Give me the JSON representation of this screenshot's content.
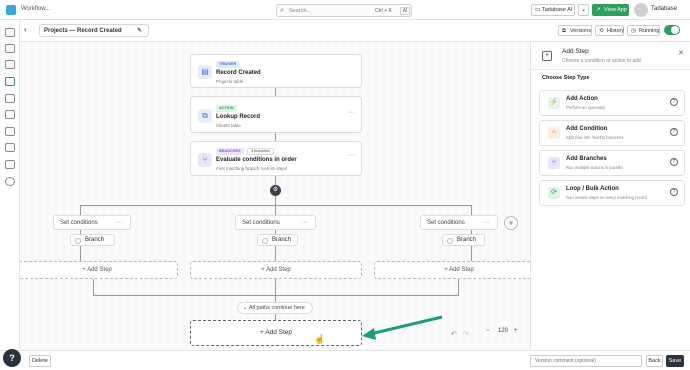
{
  "topbar": {
    "breadcrumb": "Workflow...",
    "search_placeholder": "Search...",
    "search_shortcut": "Ctrl + K",
    "search_ai": "AI",
    "tadabase_ai_label": "Tadabase AI",
    "view_app_label": "View App",
    "user_name": "Tadabase"
  },
  "toolbar": {
    "back_icon": "chevron-left-icon",
    "title": "Projects — Record Created",
    "versions_label": "Versions",
    "history_label": "History",
    "running_label": "Running",
    "running_on": true
  },
  "flow": {
    "trigger": {
      "tag": "Trigger",
      "title": "Record Created",
      "subtitle": "Projects table"
    },
    "action": {
      "tag": "Action",
      "title": "Lookup Record",
      "subtitle": "Clients table"
    },
    "branches": {
      "tag": "Branches",
      "count": "3 branches",
      "title": "Evaluate conditions in order",
      "subtitle": "First matching branch runs its steps"
    },
    "columns": [
      {
        "set_conditions": "Set conditions",
        "branch": "Branch",
        "add_step": "Add Step"
      },
      {
        "set_conditions": "Set conditions",
        "branch": "Branch",
        "add_step": "Add Step"
      },
      {
        "set_conditions": "Set conditions",
        "branch": "Branch",
        "add_step": "Add Step"
      }
    ],
    "merge_label": "All paths continue here",
    "final_add_step": "Add Step",
    "more_icon": "ellipsis-icon"
  },
  "zoom": {
    "minus": "−",
    "value": "120",
    "plus": "+"
  },
  "panel": {
    "title": "Add Step",
    "subtitle": "Choose a condition or action to add",
    "section_title": "Choose Step Type",
    "step_types": [
      {
        "title": "Add Action",
        "desc": "Perform an operation",
        "icon": "lightning-icon",
        "color": "#1aa3c9"
      },
      {
        "title": "Add Condition",
        "desc": "Split flow into Yes/No branches",
        "icon": "split-icon",
        "color": "#e08a2e"
      },
      {
        "title": "Add Branches",
        "desc": "Run multiple actions in parallel",
        "icon": "branches-icon",
        "color": "#8a5cd0"
      },
      {
        "title": "Loop / Bulk Action",
        "desc": "Run nested steps on every matching record",
        "icon": "loop-icon",
        "color": "#2e9e5b"
      }
    ]
  },
  "bottom": {
    "delete_label": "Delete",
    "version_placeholder": "Version comment (optional)",
    "back_label": "Back",
    "save_label": "Save",
    "help_label": "?"
  },
  "colors": {
    "accent": "#2e9e5b",
    "arrow": "#1f9e72"
  }
}
